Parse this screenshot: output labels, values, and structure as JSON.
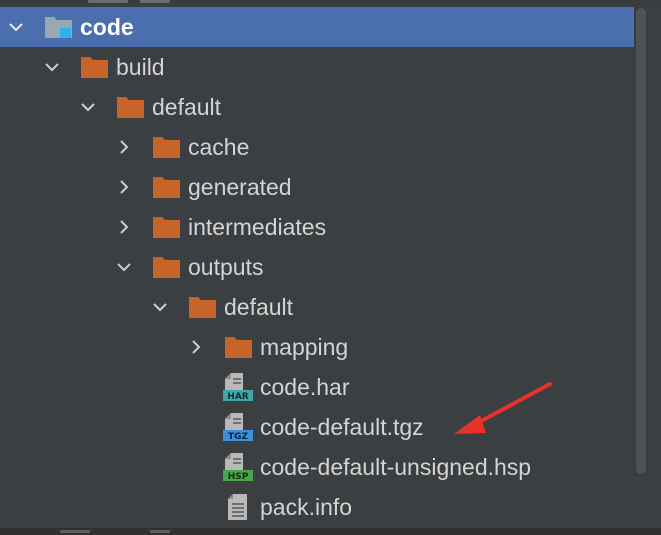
{
  "tree": {
    "root": {
      "label": "code",
      "expanded": true,
      "selected": true,
      "icon": "module-folder-icon"
    },
    "items": [
      {
        "label": "build",
        "depth": 1,
        "expanded": true,
        "icon": "folder-icon"
      },
      {
        "label": "default",
        "depth": 2,
        "expanded": true,
        "icon": "folder-icon"
      },
      {
        "label": "cache",
        "depth": 3,
        "expanded": false,
        "icon": "folder-icon"
      },
      {
        "label": "generated",
        "depth": 3,
        "expanded": false,
        "icon": "folder-icon"
      },
      {
        "label": "intermediates",
        "depth": 3,
        "expanded": false,
        "icon": "folder-icon"
      },
      {
        "label": "outputs",
        "depth": 3,
        "expanded": true,
        "icon": "folder-icon"
      },
      {
        "label": "default",
        "depth": 4,
        "expanded": true,
        "icon": "folder-icon"
      },
      {
        "label": "mapping",
        "depth": 5,
        "expanded": false,
        "icon": "folder-icon"
      },
      {
        "label": "code.har",
        "depth": 5,
        "icon": "har-file-icon",
        "badge": "HAR",
        "badge_color": "#3fa7a8"
      },
      {
        "label": "code-default.tgz",
        "depth": 5,
        "icon": "tgz-file-icon",
        "badge": "TGZ",
        "badge_color": "#3d8fd9"
      },
      {
        "label": "code-default-unsigned.hsp",
        "depth": 5,
        "icon": "hsp-file-icon",
        "badge": "HSP",
        "badge_color": "#49a34a"
      },
      {
        "label": "pack.info",
        "depth": 5,
        "icon": "text-file-icon"
      }
    ]
  },
  "colors": {
    "background": "#3c3f41",
    "selection": "#4b6eaf",
    "folder": "#c8642a",
    "arrow": "#e8312b"
  }
}
